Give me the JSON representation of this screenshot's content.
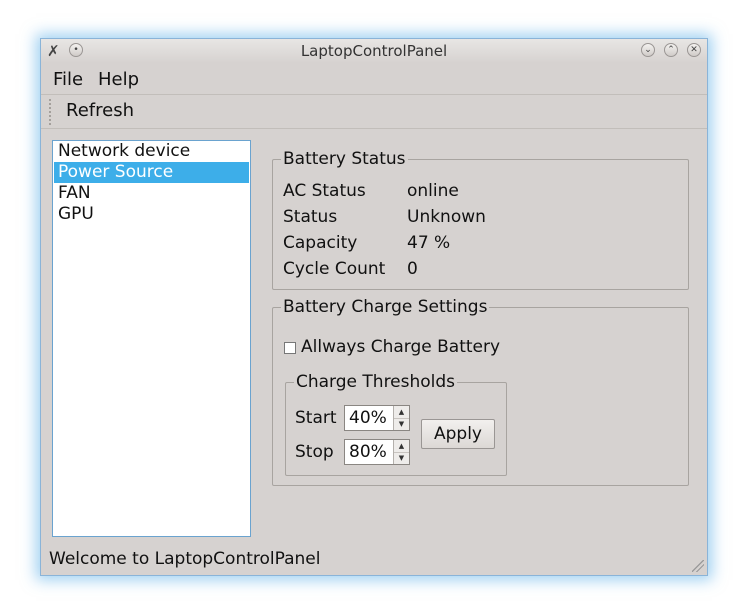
{
  "window": {
    "title": "LaptopControlPanel"
  },
  "menu": {
    "file": "File",
    "help": "Help"
  },
  "toolbar": {
    "refresh": "Refresh"
  },
  "sidebar": {
    "items": [
      {
        "label": "Network device",
        "selected": false
      },
      {
        "label": "Power Source",
        "selected": true
      },
      {
        "label": "FAN",
        "selected": false
      },
      {
        "label": "GPU",
        "selected": false
      }
    ]
  },
  "battery_status": {
    "title": "Battery Status",
    "ac_status_label": "AC Status",
    "ac_status_value": "online",
    "status_label": "Status",
    "status_value": "Unknown",
    "capacity_label": "Capacity",
    "capacity_value": "47 %",
    "cycle_count_label": "Cycle Count",
    "cycle_count_value": "0"
  },
  "charge_settings": {
    "title": "Battery Charge Settings",
    "always_charge_label": "Allways Charge Battery",
    "always_charge_checked": false,
    "thresholds": {
      "title": "Charge Thresholds",
      "start_label": "Start",
      "start_value": "40%",
      "stop_label": "Stop",
      "stop_value": "80%",
      "apply_label": "Apply"
    }
  },
  "statusbar": {
    "message": "Welcome to LaptopControlPanel"
  },
  "colors": {
    "selection": "#3daee9",
    "window_bg": "#d6d2d0",
    "glow": "#50aae6"
  }
}
